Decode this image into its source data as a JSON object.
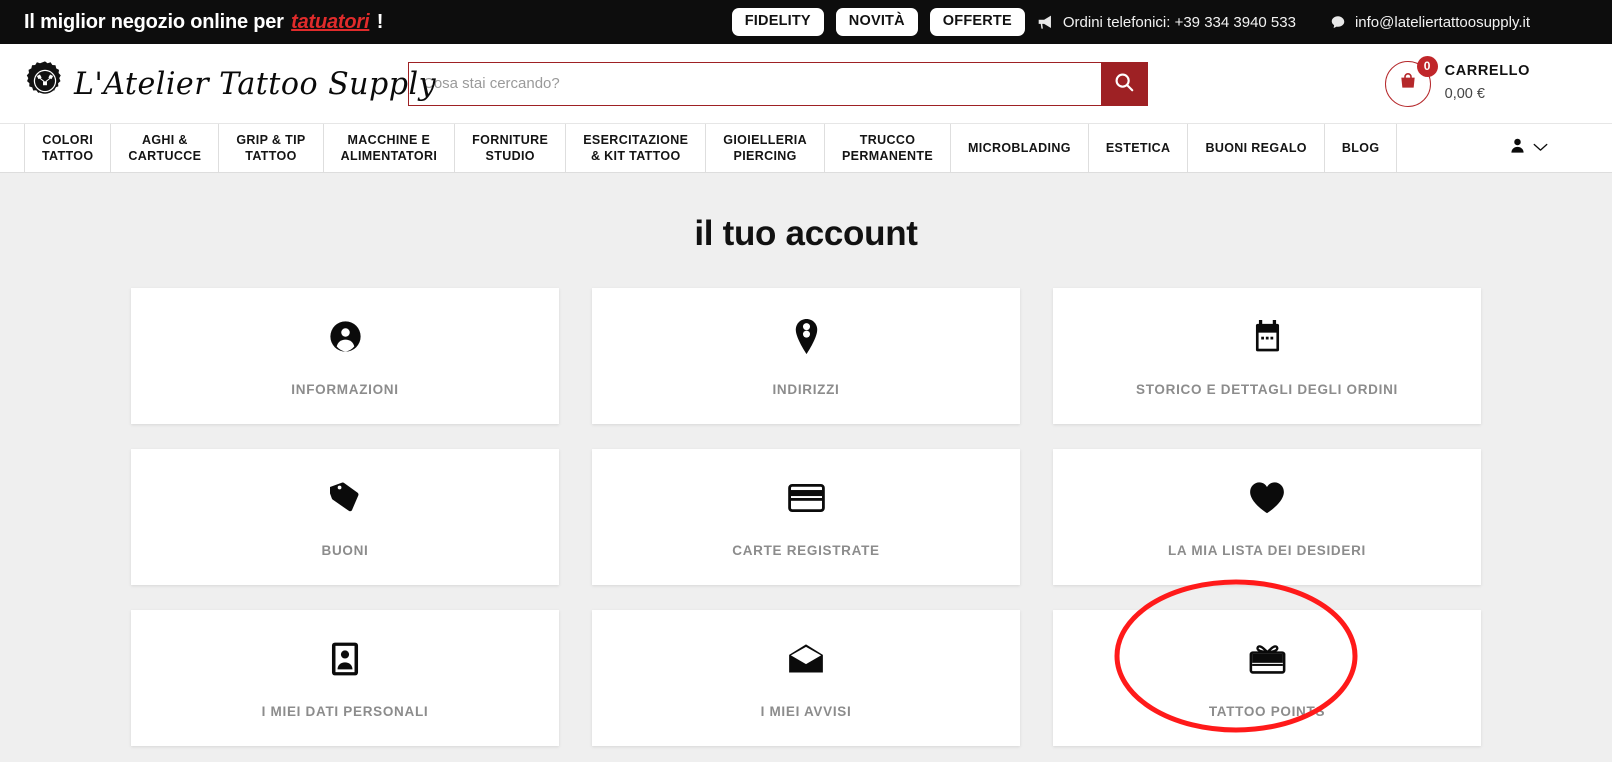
{
  "topbar": {
    "slogan_prefix": "Il miglior negozio online per",
    "slogan_highlight": "tatuatori",
    "slogan_suffix": "!",
    "pills": [
      {
        "label": "FIDELITY",
        "name": "fidelity-button"
      },
      {
        "label": "NOVITÀ",
        "name": "novita-button"
      },
      {
        "label": "OFFERTE",
        "name": "offerte-button"
      }
    ],
    "phone": {
      "icon": "megaphone-icon",
      "text": "Ordini telefonici: +39 334 3940 533"
    },
    "email": {
      "icon": "chat-bubble-icon",
      "text": "info@lateliertattoosupply.it"
    }
  },
  "header": {
    "logo_text": "L'Atelier Tattoo Supply",
    "logo_icon": "gear-tattoo-machines-icon",
    "search": {
      "placeholder": "Cosa stai cercando?",
      "value": "",
      "button_icon": "search-icon"
    },
    "cart": {
      "icon": "shopping-bag-icon",
      "count": "0",
      "title": "CARRELLO",
      "total": "0,00 €"
    }
  },
  "nav": {
    "items": [
      {
        "label": "COLORI\nTATTOO",
        "name": "nav-colori-tattoo"
      },
      {
        "label": "AGHI &\nCARTUCCE",
        "name": "nav-aghi-cartucce"
      },
      {
        "label": "GRIP & TIP\nTATTOO",
        "name": "nav-grip-tip-tattoo"
      },
      {
        "label": "MACCHINE E\nALIMENTATORI",
        "name": "nav-macchine-alimentatori"
      },
      {
        "label": "FORNITURE\nSTUDIO",
        "name": "nav-forniture-studio"
      },
      {
        "label": "ESERCITAZIONE\n& KIT TATTOO",
        "name": "nav-esercitazione-kit-tattoo"
      },
      {
        "label": "GIOIELLERIA\nPIERCING",
        "name": "nav-gioielleria-piercing"
      },
      {
        "label": "TRUCCO\nPERMANENTE",
        "name": "nav-trucco-permanente"
      },
      {
        "label": "MICROBLADING",
        "name": "nav-microblading"
      },
      {
        "label": "ESTETICA",
        "name": "nav-estetica"
      },
      {
        "label": "BUONI REGALO",
        "name": "nav-buoni-regalo"
      },
      {
        "label": "BLOG",
        "name": "nav-blog"
      }
    ],
    "user_menu": {
      "icon": "person-icon",
      "chevron": "chevron-down-icon"
    }
  },
  "main": {
    "title": "il tuo account",
    "cards": [
      {
        "label": "INFORMAZIONI",
        "icon": "account-circle-icon",
        "name": "card-informazioni"
      },
      {
        "label": "INDIRIZZI",
        "icon": "map-pin-icon",
        "name": "card-indirizzi"
      },
      {
        "label": "STORICO E DETTAGLI DEGLI ORDINI",
        "icon": "calendar-icon",
        "name": "card-storico-ordini"
      },
      {
        "label": "BUONI",
        "icon": "tag-icon",
        "name": "card-buoni"
      },
      {
        "label": "CARTE REGISTRATE",
        "icon": "credit-card-icon",
        "name": "card-carte-registrate"
      },
      {
        "label": "LA MIA LISTA DEI DESIDERI",
        "icon": "heart-icon",
        "name": "card-lista-desideri"
      },
      {
        "label": "I MIEI DATI PERSONALI",
        "icon": "id-card-icon",
        "name": "card-dati-personali"
      },
      {
        "label": "I MIEI AVVISI",
        "icon": "envelope-icon",
        "name": "card-miei-avvisi"
      },
      {
        "label": "TATTOO POINTS",
        "icon": "gift-card-icon",
        "name": "card-tattoo-points"
      }
    ]
  },
  "annotation": {
    "type": "ellipse-highlight",
    "target": "TATTOO POINTS",
    "color": "#FF1A1A"
  },
  "colors": {
    "brand_red": "#9e2124",
    "accent_red": "#e02b2b",
    "topbar_bg": "#0d0d0d",
    "page_bg": "#efefef",
    "card_bg": "#ffffff",
    "card_label": "#8c8c8c"
  }
}
